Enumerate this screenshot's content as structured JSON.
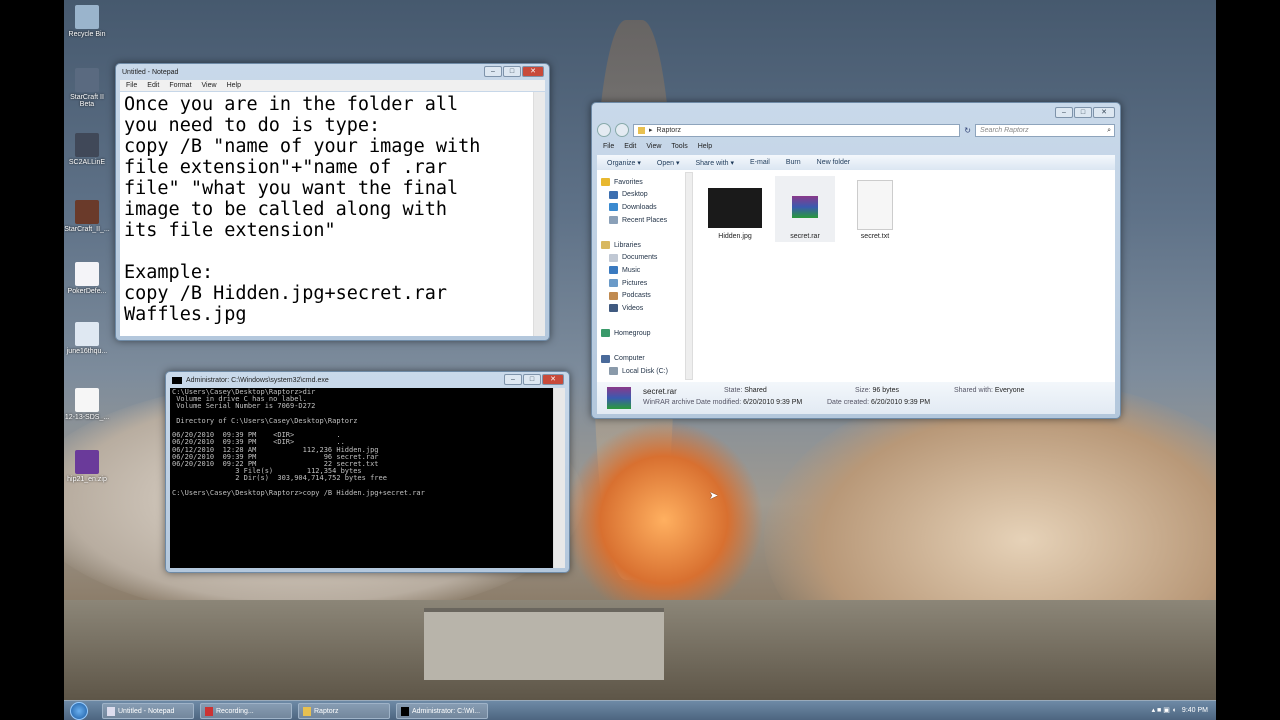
{
  "desktop_icons": [
    {
      "label": "Recycle Bin"
    },
    {
      "label": "StarCraft II Beta"
    },
    {
      "label": "SC2ALLinE"
    },
    {
      "label": "StarCraft_II_..."
    },
    {
      "label": "PokerDefe..."
    },
    {
      "label": "june16thqu..."
    },
    {
      "label": "12-13-SDS_..."
    },
    {
      "label": "hip21_en.zip"
    }
  ],
  "notepad": {
    "title": "Untitled - Notepad",
    "menu": [
      "File",
      "Edit",
      "Format",
      "View",
      "Help"
    ],
    "text": "Once you are in the folder all\nyou need to do is type:\ncopy /B \"name of your image with\nfile extension\"+\"name of .rar\nfile\" \"what you want the final\nimage to be called along with\nits file extension\"\n\nExample:\ncopy /B Hidden.jpg+secret.rar\nWaffles.jpg"
  },
  "cmd": {
    "title": "Administrator: C:\\Windows\\system32\\cmd.exe",
    "text": "C:\\Users\\Casey\\Desktop\\Raptorz>dir\n Volume in drive C has no label.\n Volume Serial Number is 7069-D272\n\n Directory of C:\\Users\\Casey\\Desktop\\Raptorz\n\n06/20/2010  09:39 PM    <DIR>          .\n06/20/2010  09:39 PM    <DIR>          ..\n06/12/2010  12:28 AM           112,236 Hidden.jpg\n06/20/2010  09:39 PM                96 secret.rar\n06/20/2010  09:22 PM                22 secret.txt\n               3 File(s)        112,354 bytes\n               2 Dir(s)  303,904,714,752 bytes free\n\nC:\\Users\\Casey\\Desktop\\Raptorz>copy /B Hidden.jpg+secret.rar"
  },
  "explorer": {
    "path": "Raptorz",
    "search_placeholder": "Search Raptorz",
    "menu": [
      "File",
      "Edit",
      "View",
      "Tools",
      "Help"
    ],
    "toolbar": [
      "Organize ▾",
      "Open ▾",
      "Share with ▾",
      "E-mail",
      "Burn",
      "New folder"
    ],
    "nav": [
      {
        "label": "Favorites",
        "indent": 0,
        "color": "#e8b830"
      },
      {
        "label": "Desktop",
        "indent": 1,
        "color": "#3c6fb0"
      },
      {
        "label": "Downloads",
        "indent": 1,
        "color": "#3a8ad0"
      },
      {
        "label": "Recent Places",
        "indent": 1,
        "color": "#8aa0b8"
      },
      {
        "label": "",
        "indent": 0,
        "color": ""
      },
      {
        "label": "Libraries",
        "indent": 0,
        "color": "#d8b860"
      },
      {
        "label": "Documents",
        "indent": 1,
        "color": "#c0c8d4"
      },
      {
        "label": "Music",
        "indent": 1,
        "color": "#3a7ac0"
      },
      {
        "label": "Pictures",
        "indent": 1,
        "color": "#6a9ac8"
      },
      {
        "label": "Podcasts",
        "indent": 1,
        "color": "#c08a50"
      },
      {
        "label": "Videos",
        "indent": 1,
        "color": "#405a80"
      },
      {
        "label": "",
        "indent": 0,
        "color": ""
      },
      {
        "label": "Homegroup",
        "indent": 0,
        "color": "#3a9a6a"
      },
      {
        "label": "",
        "indent": 0,
        "color": ""
      },
      {
        "label": "Computer",
        "indent": 0,
        "color": "#4a6a9a"
      },
      {
        "label": "Local Disk (C:)",
        "indent": 1,
        "color": "#8a9aaa"
      }
    ],
    "files": [
      {
        "name": "Hidden.jpg"
      },
      {
        "name": "secret.rar"
      },
      {
        "name": "secret.txt"
      }
    ],
    "details": {
      "name": "secret.rar",
      "type": "WinRAR archive",
      "state_label": "State:",
      "state": "Shared",
      "modified_label": "Date modified:",
      "modified": "6/20/2010 9:39 PM",
      "size_label": "Size:",
      "size": "96 bytes",
      "created_label": "Date created:",
      "created": "6/20/2010 9:39 PM",
      "shared_label": "Shared with:",
      "shared": "Everyone"
    }
  },
  "taskbar": {
    "tasks": [
      "Untitled - Notepad",
      "Recording...",
      "Raptorz",
      "Administrator: C:\\Wi..."
    ],
    "clock": "9:40 PM"
  }
}
